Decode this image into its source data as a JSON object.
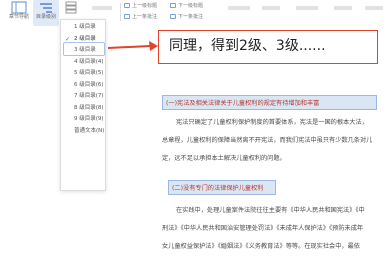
{
  "toolbar": {
    "nav_label": "章节导航",
    "outline_label": "目录级别",
    "level_label": "",
    "prev_top_label": "上一级标题",
    "prev_label": "上一条批注",
    "next_top_label": "下一级标题",
    "next_label": "下一条批注"
  },
  "dropdown": {
    "items": [
      {
        "label": "1 级目录",
        "checked": false
      },
      {
        "label": "2 级目录",
        "checked": true
      },
      {
        "label": "3 级目录",
        "checked": false
      },
      {
        "label": "4 级目录(4)",
        "checked": false
      },
      {
        "label": "5 级目录(5)",
        "checked": false
      },
      {
        "label": "6 级目录(6)",
        "checked": false
      },
      {
        "label": "7 级目录(7)",
        "checked": false
      },
      {
        "label": "8 级目录(8)",
        "checked": false
      },
      {
        "label": "9 级目录(9)",
        "checked": false
      },
      {
        "label": "普通文本(N)",
        "checked": false
      }
    ]
  },
  "callout": {
    "text": "同理，得到2级、3级......"
  },
  "document": {
    "heading1": "(一)宪法及相关法律关于儿童权利的规定有待增加和丰富",
    "para1": [
      "宪法只确定了儿童权利保护制度的首要体系，宪法是一国的根本大法，",
      "总章程，儿童权利的保障当然离不开宪法，而我们宪法中虽只有少数几条对儿",
      "定，远不足以承担本土解决儿童权利的问题。"
    ],
    "heading2": "(二)没有专门的法律保护儿童权利",
    "para2": [
      "在实践中，处理儿童案件法院往往主要有《中华人民共和国宪法》《中",
      "刑法》《中华人民共和国治安管理处罚法》《未成年人保护法》《预防未成年",
      "女儿童权益保护法》《婚姻法》《义务教育法》等等。在现实社会中，最依"
    ]
  }
}
